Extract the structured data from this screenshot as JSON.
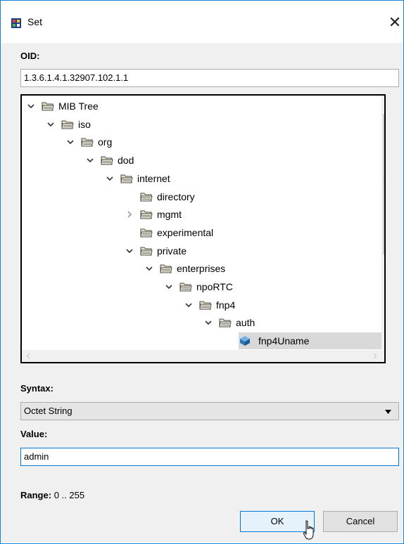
{
  "window": {
    "title": "Set",
    "close_glyph": "✕"
  },
  "oid": {
    "label": "OID:",
    "value": "1.3.6.1.4.1.32907.102.1.1"
  },
  "tree": {
    "nodes": [
      {
        "label": "MIB Tree",
        "depth": 0,
        "expander": "expanded"
      },
      {
        "label": "iso",
        "depth": 1,
        "expander": "expanded"
      },
      {
        "label": "org",
        "depth": 2,
        "expander": "expanded"
      },
      {
        "label": "dod",
        "depth": 3,
        "expander": "expanded"
      },
      {
        "label": "internet",
        "depth": 4,
        "expander": "expanded"
      },
      {
        "label": "directory",
        "depth": 5,
        "expander": "none"
      },
      {
        "label": "mgmt",
        "depth": 5,
        "expander": "collapsed"
      },
      {
        "label": "experimental",
        "depth": 5,
        "expander": "none"
      },
      {
        "label": "private",
        "depth": 5,
        "expander": "expanded"
      },
      {
        "label": "enterprises",
        "depth": 6,
        "expander": "expanded"
      },
      {
        "label": "npoRTC",
        "depth": 7,
        "expander": "expanded"
      },
      {
        "label": "fnp4",
        "depth": 8,
        "expander": "expanded"
      },
      {
        "label": "auth",
        "depth": 9,
        "expander": "expanded"
      },
      {
        "label": "fnp4Uname",
        "depth": 10,
        "expander": "none",
        "leaf": true,
        "selected": true
      }
    ]
  },
  "syntax": {
    "label": "Syntax:",
    "selected": "Octet String"
  },
  "value": {
    "label": "Value:",
    "current": "admin"
  },
  "range": {
    "label": "Range:",
    "text": "0 .. 255"
  },
  "buttons": {
    "ok": "OK",
    "cancel": "Cancel"
  },
  "colors": {
    "accent": "#1883d7",
    "focus_border": "#0078d7",
    "selection": "#d9d9d9"
  }
}
